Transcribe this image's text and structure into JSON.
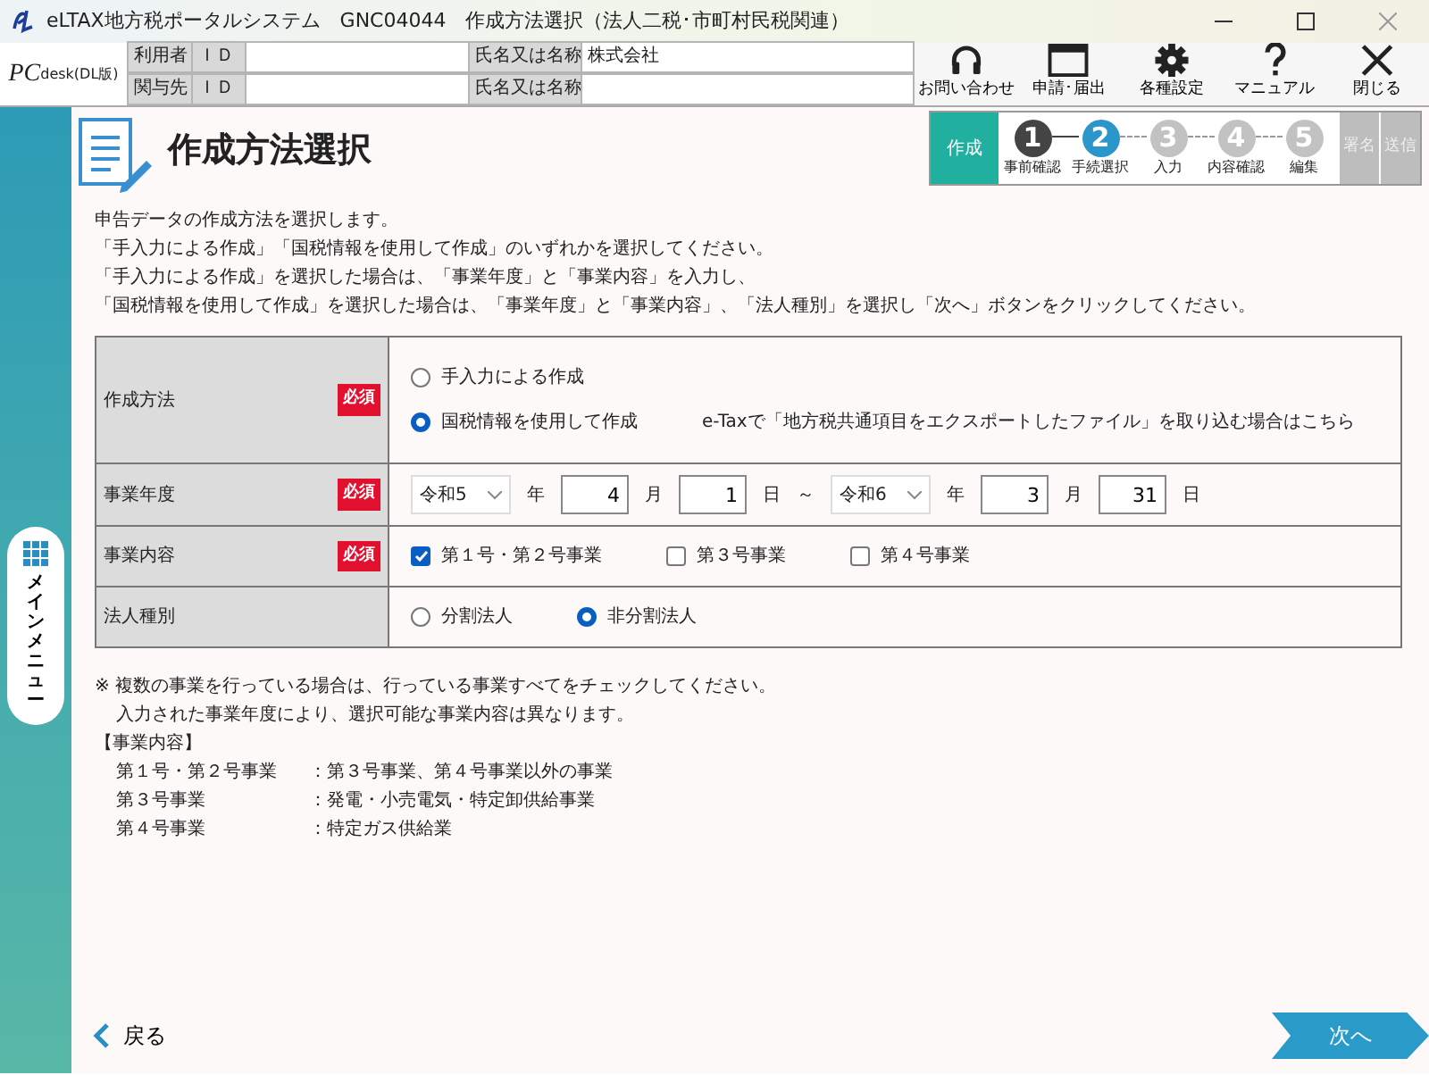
{
  "window": {
    "title": "eLTAX地方税ポータルシステム　GNC04044　作成方法選択（法人二税･市町村民税関連）"
  },
  "logo": {
    "main": "PC",
    "sub": "desk",
    "edition": "(DL版)"
  },
  "user_info": [
    {
      "role": "利用者",
      "id_label": "ＩＤ",
      "name_label": "氏名又は名称",
      "name_value": "株式会社"
    },
    {
      "role": "関与先",
      "id_label": "ＩＤ",
      "name_label": "氏名又は名称"
    }
  ],
  "toolbar": [
    {
      "kind": "headset",
      "label": "お問い合わせ"
    },
    {
      "kind": "window",
      "label": "申請･届出"
    },
    {
      "kind": "gear",
      "label": "各種設定"
    },
    {
      "kind": "help",
      "label": "マニュアル"
    },
    {
      "kind": "close",
      "label": "閉じる"
    }
  ],
  "side_menu": {
    "label": "メインメニュー"
  },
  "page_title": "作成方法選択",
  "flow": {
    "phase": "作成",
    "steps": [
      {
        "number": "1",
        "label": "事前確認",
        "completed": true,
        "selected": false
      },
      {
        "number": "2",
        "label": "手続選択",
        "completed": false,
        "selected": true
      },
      {
        "number": "3",
        "label": "入力",
        "completed": false,
        "selected": false
      },
      {
        "number": "4",
        "label": "内容確認",
        "completed": false,
        "selected": false
      },
      {
        "number": "5",
        "label": "編集",
        "completed": false,
        "selected": false
      }
    ],
    "later_phases": [
      "署名",
      "送信"
    ]
  },
  "instructions": [
    "申告データの作成方法を選択します。",
    "「手入力による作成」「国税情報を使用して作成」のいずれかを選択してください。",
    "「手入力による作成」を選択した場合は、「事業年度」と「事業内容」を入力し、",
    "「国税情報を使用して作成」を選択した場合は、「事業年度」と「事業内容」、「法人種別」を選択し「次へ」ボタンをクリックしてください。"
  ],
  "form": [
    {
      "kind": "radio",
      "label": "作成方法",
      "required": true,
      "required_label": "必須",
      "options": [
        {
          "label": "手入力による作成",
          "selected": false
        },
        {
          "label": "国税情報を使用して作成",
          "selected": true,
          "link": "e-Taxで「地方税共通項目をエクスポートしたファイル」を取り込む場合はこちら"
        }
      ]
    },
    {
      "kind": "date_range",
      "label": "事業年度",
      "required": true,
      "required_label": "必須",
      "from": {
        "era": "令和5",
        "year_unit": "年",
        "month": "4",
        "month_unit": "月",
        "day": "1",
        "day_unit": "日"
      },
      "separator": "～",
      "to": {
        "era": "令和6",
        "year_unit": "年",
        "month": "3",
        "month_unit": "月",
        "day": "31",
        "day_unit": "日"
      }
    },
    {
      "kind": "checkbox",
      "label": "事業内容",
      "required": true,
      "required_label": "必須",
      "options": [
        {
          "label": "第１号・第２号事業",
          "checked": true
        },
        {
          "label": "第３号事業",
          "checked": false
        },
        {
          "label": "第４号事業",
          "checked": false
        }
      ]
    },
    {
      "kind": "radio",
      "label": "法人種別",
      "required": false,
      "options": [
        {
          "label": "分割法人",
          "selected": false
        },
        {
          "label": "非分割法人",
          "selected": true
        }
      ]
    }
  ],
  "notes": [
    "※ 複数の事業を行っている場合は、行っている事業すべてをチェックしてください。",
    "入力された事業年度により、選択可能な事業内容は異なります。"
  ],
  "legend": {
    "title": "【事業内容】",
    "rows": [
      {
        "term": "第１号・第２号事業",
        "description": "：第３号事業、第４号事業以外の事業"
      },
      {
        "term": "第３号事業",
        "description": "：発電・小売電気・特定卸供給事業"
      },
      {
        "term": "第４号事業",
        "description": "：特定ガス供給業"
      }
    ]
  },
  "footer": {
    "back": "戻る",
    "next": "次へ"
  }
}
